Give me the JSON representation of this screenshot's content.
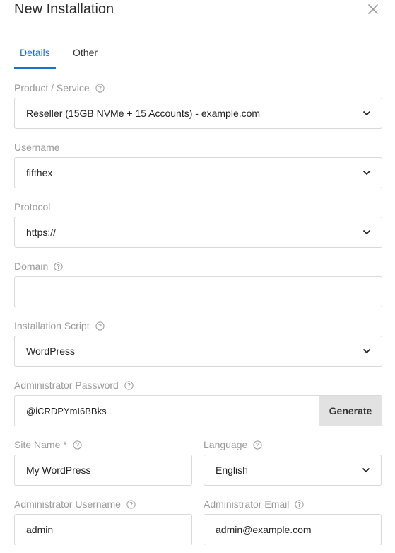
{
  "dialog": {
    "title": "New Installation"
  },
  "tabs": [
    {
      "label": "Details",
      "active": true
    },
    {
      "label": "Other",
      "active": false
    }
  ],
  "icons": {
    "close": "close-icon",
    "help": "help-circle-icon",
    "dropdown": "chevron-down-icon"
  },
  "colors": {
    "accent": "#1a73c8",
    "label": "#9a9a9a",
    "border": "#d9d9d9",
    "button_bg": "#e2e2e2"
  },
  "form": {
    "product": {
      "label": "Product / Service",
      "value": "Reseller (15GB NVMe + 15 Accounts) - example.com"
    },
    "username": {
      "label": "Username",
      "value": "fifthex"
    },
    "protocol": {
      "label": "Protocol",
      "value": "https://"
    },
    "domain": {
      "label": "Domain",
      "value": ""
    },
    "script": {
      "label": "Installation Script",
      "value": "WordPress"
    },
    "admin_password": {
      "label": "Administrator Password",
      "value": "@iCRDPYmI6BBks",
      "generate_label": "Generate"
    },
    "site_name": {
      "label": "Site Name *",
      "value": "My WordPress"
    },
    "language": {
      "label": "Language",
      "value": "English"
    },
    "admin_username": {
      "label": "Administrator Username",
      "value": "admin"
    },
    "admin_email": {
      "label": "Administrator Email",
      "value": "admin@example.com"
    }
  }
}
